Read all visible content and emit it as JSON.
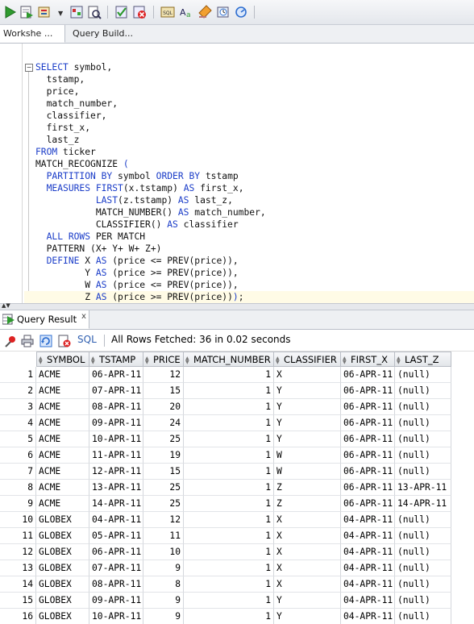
{
  "toolbar": {
    "icons": [
      "run-statement-icon",
      "run-script-icon",
      "autotrace-icon",
      "explain-plan-icon",
      "sql-tuning-icon",
      "commit-icon",
      "rollback-icon",
      "unshared-sql-icon",
      "to-upper-icon",
      "clear-icon",
      "history-icon",
      "sql-monitor-icon"
    ]
  },
  "editor_tabs": [
    {
      "label": "Workshe ..."
    },
    {
      "label": "Query Build..."
    }
  ],
  "code_lines": [
    [
      [
        "kw",
        "SELECT"
      ],
      [
        "t",
        " symbol,"
      ]
    ],
    [
      [
        "t",
        "  tstamp,"
      ]
    ],
    [
      [
        "t",
        "  price,"
      ]
    ],
    [
      [
        "t",
        "  match_number,"
      ]
    ],
    [
      [
        "t",
        "  classifier,"
      ]
    ],
    [
      [
        "t",
        "  first_x,"
      ]
    ],
    [
      [
        "t",
        "  last_z"
      ]
    ],
    [
      [
        "kw",
        "FROM"
      ],
      [
        "t",
        " ticker"
      ]
    ],
    [
      [
        "t",
        "MATCH_RECOGNIZE "
      ],
      [
        "kw",
        "("
      ]
    ],
    [
      [
        "t",
        "  "
      ],
      [
        "kw",
        "PARTITION BY"
      ],
      [
        "t",
        " symbol "
      ],
      [
        "kw",
        "ORDER BY"
      ],
      [
        "t",
        " tstamp"
      ]
    ],
    [
      [
        "t",
        "  "
      ],
      [
        "kw",
        "MEASURES"
      ],
      [
        "t",
        " "
      ],
      [
        "kw",
        "FIRST"
      ],
      [
        "t",
        "(x.tstamp) "
      ],
      [
        "kw",
        "AS"
      ],
      [
        "t",
        " first_x,"
      ]
    ],
    [
      [
        "t",
        "           "
      ],
      [
        "kw",
        "LAST"
      ],
      [
        "t",
        "(z.tstamp) "
      ],
      [
        "kw",
        "AS"
      ],
      [
        "t",
        " last_z,"
      ]
    ],
    [
      [
        "t",
        "           MATCH_NUMBER() "
      ],
      [
        "kw",
        "AS"
      ],
      [
        "t",
        " match_number,"
      ]
    ],
    [
      [
        "t",
        "           CLASSIFIER() "
      ],
      [
        "kw",
        "AS"
      ],
      [
        "t",
        " classifier"
      ]
    ],
    [
      [
        "t",
        "  "
      ],
      [
        "kw",
        "ALL ROWS"
      ],
      [
        "t",
        " PER MATCH"
      ]
    ],
    [
      [
        "t",
        "  PATTERN (X+ Y+ W+ Z+)"
      ]
    ],
    [
      [
        "t",
        "  "
      ],
      [
        "kw",
        "DEFINE"
      ],
      [
        "t",
        " X "
      ],
      [
        "kw",
        "AS"
      ],
      [
        "t",
        " (price <= PREV(price)),"
      ]
    ],
    [
      [
        "t",
        "         Y "
      ],
      [
        "kw",
        "AS"
      ],
      [
        "t",
        " (price >= PREV(price)),"
      ]
    ],
    [
      [
        "t",
        "         W "
      ],
      [
        "kw",
        "AS"
      ],
      [
        "t",
        " (price <= PREV(price)),"
      ]
    ],
    [
      [
        "t",
        "         Z "
      ],
      [
        "kw",
        "AS"
      ],
      [
        "t",
        " (price >= PREV(price))"
      ],
      [
        "kw",
        ")"
      ],
      [
        "t",
        ";"
      ]
    ]
  ],
  "results": {
    "tab_label": "Query Result",
    "close_glyph": "x",
    "sql_label": "SQL",
    "status": "All Rows Fetched: 36 in 0.02 seconds",
    "columns": [
      "SYMBOL",
      "TSTAMP",
      "PRICE",
      "MATCH_NUMBER",
      "CLASSIFIER",
      "FIRST_X",
      "LAST_Z"
    ],
    "rows": [
      [
        "1",
        "ACME",
        "06-APR-11",
        "12",
        "1",
        "X",
        "06-APR-11",
        "(null)"
      ],
      [
        "2",
        "ACME",
        "07-APR-11",
        "15",
        "1",
        "Y",
        "06-APR-11",
        "(null)"
      ],
      [
        "3",
        "ACME",
        "08-APR-11",
        "20",
        "1",
        "Y",
        "06-APR-11",
        "(null)"
      ],
      [
        "4",
        "ACME",
        "09-APR-11",
        "24",
        "1",
        "Y",
        "06-APR-11",
        "(null)"
      ],
      [
        "5",
        "ACME",
        "10-APR-11",
        "25",
        "1",
        "Y",
        "06-APR-11",
        "(null)"
      ],
      [
        "6",
        "ACME",
        "11-APR-11",
        "19",
        "1",
        "W",
        "06-APR-11",
        "(null)"
      ],
      [
        "7",
        "ACME",
        "12-APR-11",
        "15",
        "1",
        "W",
        "06-APR-11",
        "(null)"
      ],
      [
        "8",
        "ACME",
        "13-APR-11",
        "25",
        "1",
        "Z",
        "06-APR-11",
        "13-APR-11"
      ],
      [
        "9",
        "ACME",
        "14-APR-11",
        "25",
        "1",
        "Z",
        "06-APR-11",
        "14-APR-11"
      ],
      [
        "10",
        "GLOBEX",
        "04-APR-11",
        "12",
        "1",
        "X",
        "04-APR-11",
        "(null)"
      ],
      [
        "11",
        "GLOBEX",
        "05-APR-11",
        "11",
        "1",
        "X",
        "04-APR-11",
        "(null)"
      ],
      [
        "12",
        "GLOBEX",
        "06-APR-11",
        "10",
        "1",
        "X",
        "04-APR-11",
        "(null)"
      ],
      [
        "13",
        "GLOBEX",
        "07-APR-11",
        "9",
        "1",
        "X",
        "04-APR-11",
        "(null)"
      ],
      [
        "14",
        "GLOBEX",
        "08-APR-11",
        "8",
        "1",
        "X",
        "04-APR-11",
        "(null)"
      ],
      [
        "15",
        "GLOBEX",
        "09-APR-11",
        "9",
        "1",
        "Y",
        "04-APR-11",
        "(null)"
      ],
      [
        "16",
        "GLOBEX",
        "10-APR-11",
        "9",
        "1",
        "Y",
        "04-APR-11",
        "(null)"
      ]
    ]
  },
  "colors": {
    "keyword": "#1a3cc8",
    "run": "#2e9a2e",
    "accent": "#2f6fd0"
  }
}
